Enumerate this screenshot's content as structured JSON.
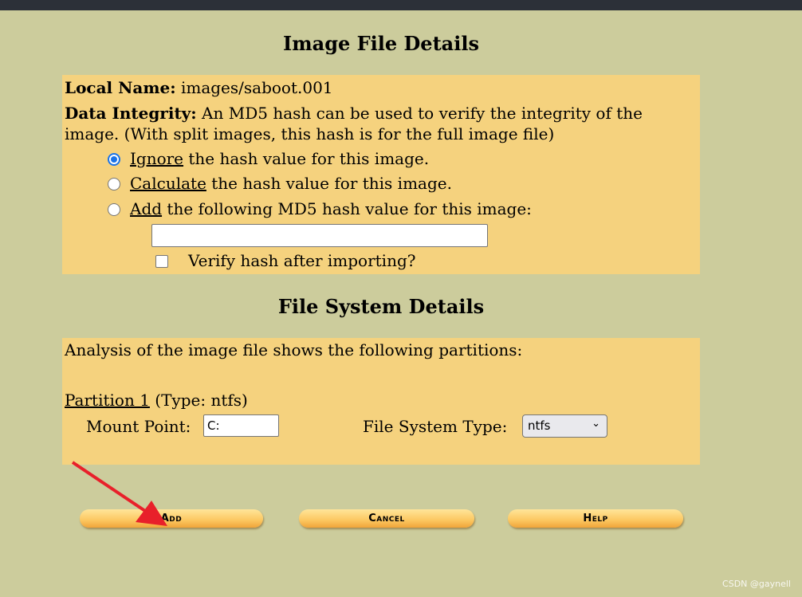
{
  "image_details": {
    "title": "Image File Details",
    "local_name_label": "Local Name:",
    "local_name_value": "images/saboot.001",
    "integrity_label": "Data Integrity:",
    "integrity_text_1": "An MD5 hash can be used to verify the integrity of the",
    "integrity_text_2": "image. (With split images, this hash is for the full image file)",
    "options": [
      {
        "key": "Ignore",
        "rest": " the hash value for this image.",
        "selected": true
      },
      {
        "key": "Calculate",
        "rest": " the hash value for this image.",
        "selected": false
      },
      {
        "key": "Add",
        "rest": " the following MD5 hash value for this image:",
        "selected": false
      }
    ],
    "md5_value": "",
    "verify_label": "Verify hash after importing?",
    "verify_checked": false
  },
  "fs_details": {
    "title": "File System Details",
    "intro": "Analysis of the image file shows the following partitions:",
    "partition_link": "Partition 1",
    "partition_type": " (Type: ntfs)",
    "mount_label": "Mount Point:",
    "mount_value": "C:",
    "fstype_label": "File System Type:",
    "fstype_value": "ntfs"
  },
  "buttons": {
    "add": "Add",
    "cancel": "Cancel",
    "help": "Help"
  },
  "watermark": "CSDN @gaynell",
  "colors": {
    "background": "#cccc9c",
    "panel": "#f5d27e",
    "annotation_arrow": "#e8202a"
  }
}
